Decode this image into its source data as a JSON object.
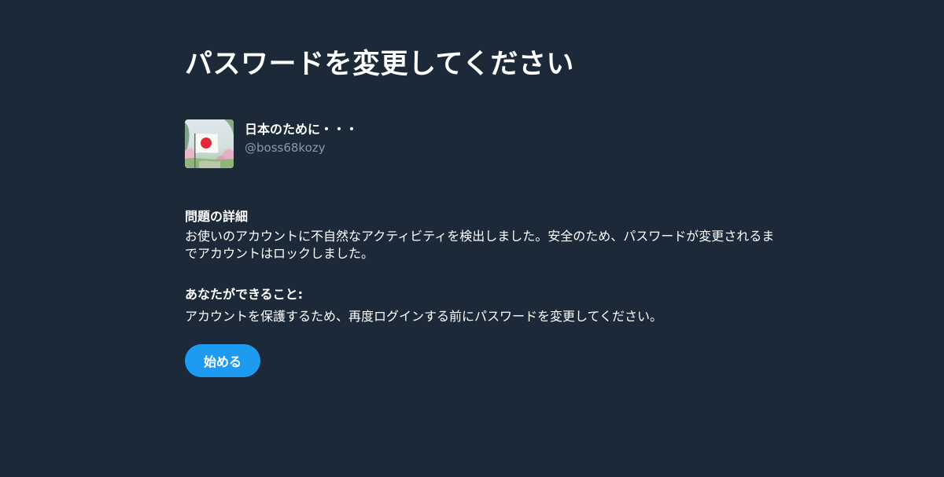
{
  "page": {
    "title": "パスワードを変更してください"
  },
  "account": {
    "display_name": "日本のために・・・",
    "handle": "@boss68kozy"
  },
  "details": {
    "heading": "問題の詳細",
    "body": "お使いのアカウントに不自然なアクティビティを検出しました。安全のため、パスワードが変更されるまでアカウントはロックしました。"
  },
  "actions": {
    "heading": "あなたができること:",
    "body": "アカウントを保護するため、再度ログインする前にパスワードを変更してください。"
  },
  "start_button": {
    "label": "始める"
  },
  "colors": {
    "background": "#1c2938",
    "text": "#ffffff",
    "secondary_text": "#8b98a5",
    "accent": "#1d9bf0"
  },
  "icons": {
    "avatar": "japan-flag-avatar"
  }
}
